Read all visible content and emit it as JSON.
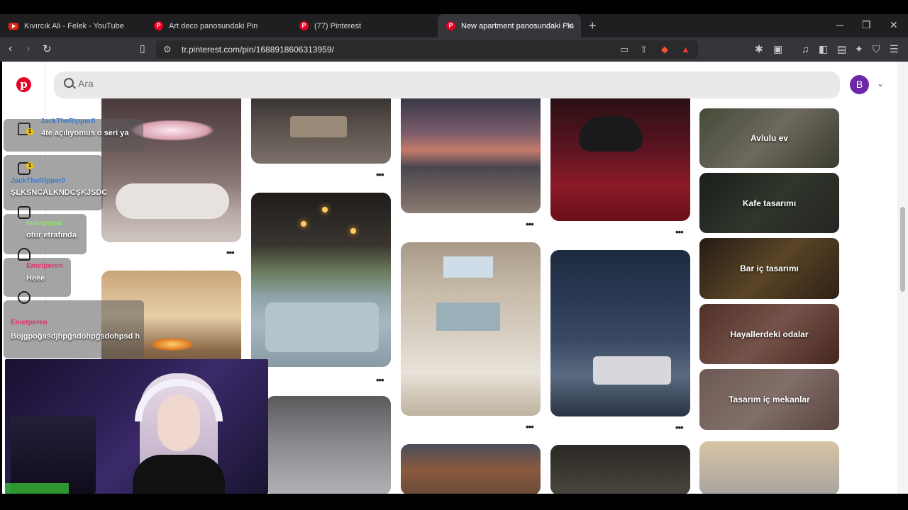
{
  "browser": {
    "tabs": [
      {
        "title": "Kıvırcık Ali - Felek - YouTube",
        "icon": "youtube-icon"
      },
      {
        "title": "Art deco panosundaki Pin",
        "icon": "pinterest-icon"
      },
      {
        "title": "(77) Pinterest",
        "icon": "pinterest-icon"
      },
      {
        "title": "New apartment panosundaki Pin",
        "icon": "pinterest-icon"
      }
    ],
    "new_tab": "+",
    "url": "tr.pinterest.com/pin/1688918606313959/"
  },
  "pinterest": {
    "search_placeholder": "Ara",
    "avatar_letter": "B",
    "more_label": "•••",
    "boards": [
      {
        "title": "Avlulu ev"
      },
      {
        "title": "Kafe tasarımı"
      },
      {
        "title": "Bar iç tasarımı"
      },
      {
        "title": "Hayallerdeki odalar"
      },
      {
        "title": "Tasarım iç mekanlar"
      }
    ]
  },
  "chat": {
    "messages": [
      {
        "user": "JackTheRipper0",
        "text": "4te açılıyomus o seri ya",
        "user_color": "#3a7bd5"
      },
      {
        "user": "JackTheRipper0",
        "text": "ŞLKSNCALKNDCŞKJSDC",
        "user_color": "#3a7bd5"
      },
      {
        "user": "kokopopsi",
        "text": "otur etrafında",
        "user_color": "#8ee66b"
      },
      {
        "user": "Emetperen",
        "text": "Heee",
        "user_color": "#e0306e"
      },
      {
        "user": "Emetperen",
        "text": "Bojgpoğasdjhpğsdohpğsdohpsd h",
        "user_color": "#e0306e"
      }
    ]
  },
  "colors": {
    "pinterest_red": "#e60023",
    "avatar_purple": "#6d28a8",
    "brave_orange": "#fb542b"
  }
}
